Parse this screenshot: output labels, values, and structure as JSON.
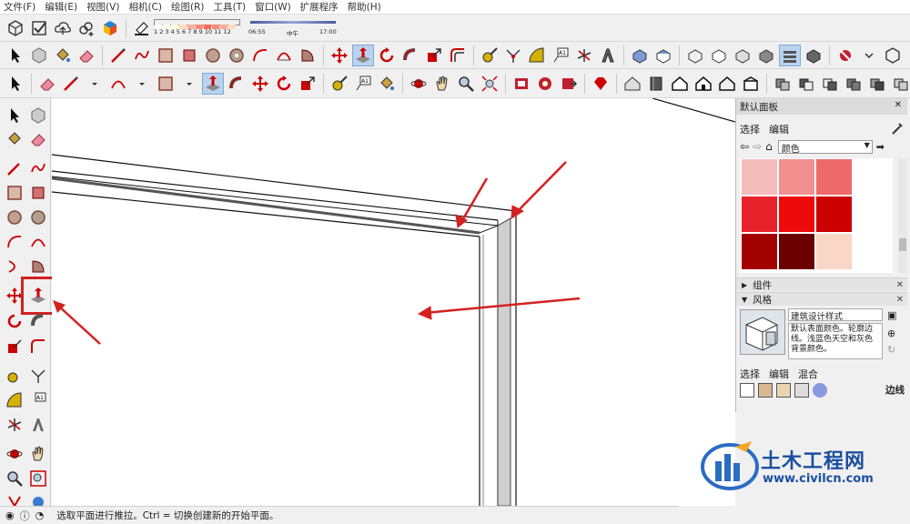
{
  "menu": [
    "文件(F)",
    "编辑(E)",
    "视图(V)",
    "相机(C)",
    "绘图(R)",
    "工具(T)",
    "窗口(W)",
    "扩展程序",
    "帮助(H)"
  ],
  "shadow": {
    "hours": "1 2 3 4 5 6 7 8 9 10 11 12",
    "time_start": "06:55",
    "time_mid": "中午",
    "time_end": "17:00"
  },
  "panel": {
    "title": "默认面板",
    "close": "✕",
    "tabs": [
      "选择",
      "编辑"
    ],
    "material_select": "颜色",
    "swatches": [
      "#f5bcbc",
      "#f29090",
      "#ee6a6a",
      "#e8222a",
      "#ee0a0a",
      "#cc0000",
      "#a30000",
      "#6a0000",
      "#f9d6c6"
    ],
    "components_label": "组件",
    "style_label": "风格",
    "style_name": "建筑设计样式",
    "style_desc": "默认表面颜色。轮廓边线。浅蓝色天空和灰色背景颜色。",
    "style_tabs": [
      "选择",
      "编辑",
      "混合"
    ],
    "edges_label": "边线"
  },
  "status": {
    "hint": "选取平面进行推拉。Ctrl = 切换创建新的开始平面。"
  },
  "watermark": {
    "name": "土木工程网",
    "url": "www.civilcn.com"
  },
  "colors": {
    "accent": "#c00000",
    "selection": "#b9d3ef",
    "arrow": "#d42020"
  }
}
